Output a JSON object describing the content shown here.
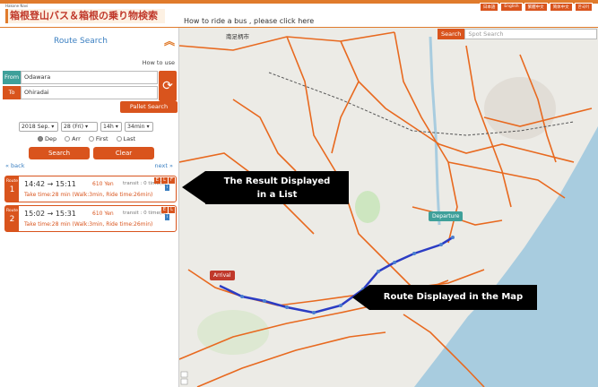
{
  "header": {
    "brand_small": "Hakone Navi",
    "title": "箱根登山バス＆箱根の乗り物検索",
    "how_to_link": "How to ride a bus , please click here",
    "languages": [
      "日本語",
      "English",
      "繁體中文",
      "简体中文",
      "한국어"
    ]
  },
  "panel": {
    "title": "Route Search",
    "how_to_use": "How to use",
    "from_label": "From",
    "from_value": "Odawara",
    "to_label": "To",
    "to_value": "Ohiradai",
    "pallet_button": "Pallet Search",
    "date": {
      "year_month": "2018 Sep.",
      "day": "28 (Fri)",
      "hour": "14h",
      "minute": "34min"
    },
    "modes": [
      {
        "label": "Dep",
        "selected": true
      },
      {
        "label": "Arr",
        "selected": false
      },
      {
        "label": "First",
        "selected": false
      },
      {
        "label": "Last",
        "selected": false
      }
    ],
    "search_button": "Search",
    "clear_button": "Clear",
    "back": "« back",
    "next": "next »",
    "results": [
      {
        "route_label": "Route",
        "route_number": "1",
        "times": "14:42 → 15:11",
        "fare": "610 Yen",
        "transit": "transit : 0 time(s)",
        "detail": "Take time:28 min (Walk:3min, Ride time:26min)",
        "flags": [
          "E",
          "L",
          "F"
        ]
      },
      {
        "route_label": "Route",
        "route_number": "2",
        "times": "15:02 → 15:31",
        "fare": "610 Yen",
        "transit": "transit : 0 time(s)",
        "detail": "Take time:28 min (Walk:3min, Ride time:26min)",
        "flags": [
          "E",
          "L"
        ]
      }
    ]
  },
  "map": {
    "search_button": "Search",
    "search_placeholder": "Spot Search",
    "city_label": "南足柄市",
    "departure_marker": "Departure",
    "arrival_marker": "Arrival",
    "colors": {
      "land": "#ecebe6",
      "sea": "#a8ccdf",
      "road": "#e8691f",
      "route": "#2b3cc4",
      "park": "#cde6c0"
    }
  },
  "callouts": {
    "list_line1": "The Result Displayed",
    "list_line2": "in a List",
    "map": "Route Displayed in the Map"
  }
}
